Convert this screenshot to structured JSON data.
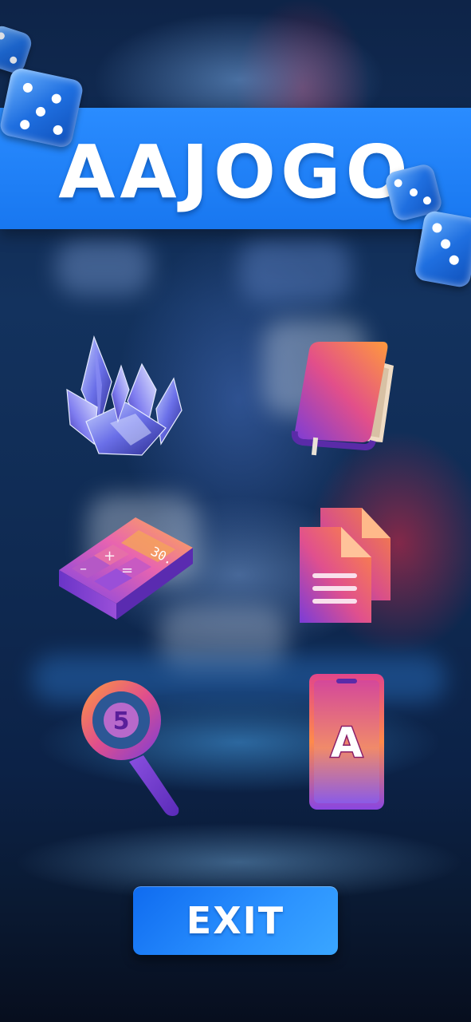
{
  "header": {
    "logo_text": "AAJOGO"
  },
  "decorations": {
    "dice": [
      "dice-icon",
      "dice-icon",
      "dice-icon",
      "dice-icon"
    ]
  },
  "menu": {
    "items": [
      {
        "icon": "crystal-icon"
      },
      {
        "icon": "book-icon"
      },
      {
        "icon": "calculator-icon",
        "display": "30."
      },
      {
        "icon": "documents-icon"
      },
      {
        "icon": "magnifier-icon",
        "glyph": "5"
      },
      {
        "icon": "smartphone-icon",
        "glyph": "A"
      }
    ]
  },
  "footer": {
    "exit_label": "EXIT"
  },
  "colors": {
    "banner": "#1877f0",
    "button": "#2b92ff",
    "icon_gradient_start": "#ff8a3d",
    "icon_gradient_end": "#7b3cf0"
  }
}
